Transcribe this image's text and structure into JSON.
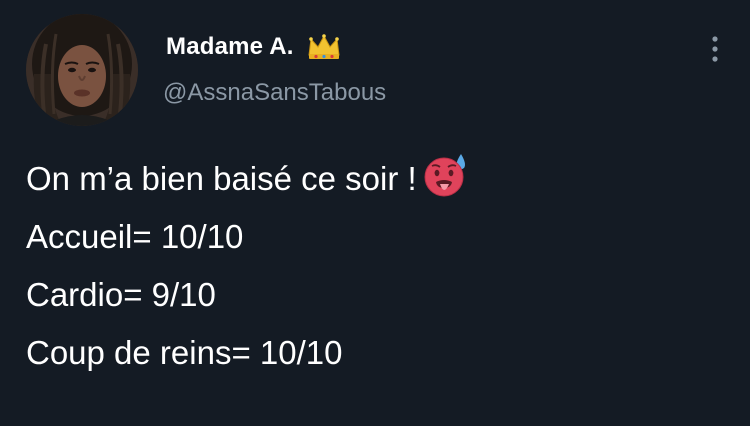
{
  "author": {
    "display_name": "Madame A.",
    "handle": "@AssnaSansTabous",
    "badge_icon": "crown-emoji"
  },
  "tweet": {
    "lines": [
      "On m’a bien baisé ce soir !",
      "Accueil= 10/10",
      "Cardio= 9/10",
      "Coup de reins= 10/10"
    ],
    "emoji": "hot-face-emoji"
  },
  "menu": {
    "icon": "more-options-icon"
  },
  "colors": {
    "background": "#141b24",
    "primary_text": "#ffffff",
    "secondary_text": "#8b98a5"
  }
}
